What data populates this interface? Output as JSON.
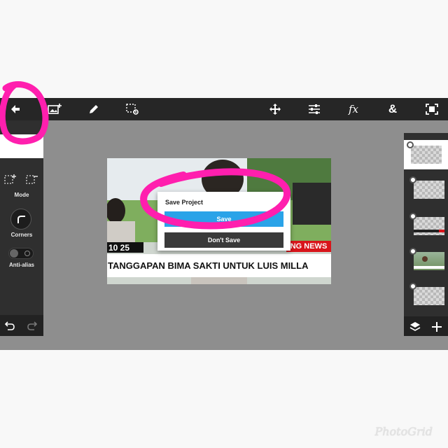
{
  "left_panel": {
    "mode_label": "Mode",
    "corners_label": "Corners",
    "antialias_label": "Anti-alias"
  },
  "dialog": {
    "title": "Save Project",
    "save_label": "Save",
    "dont_save_label": "Don't Save"
  },
  "image": {
    "time_text": "10 25",
    "news_tag": "NG NEWS",
    "headline": "TANGGAPAN BIMA SAKTI UNTUK LUIS MILLA"
  },
  "toolbar": {
    "fx_label": "fx",
    "amp_label": "&"
  },
  "watermark": "PhotoGrid",
  "colors": {
    "accent_blue": "#2aa3e8",
    "annotation_pink": "#ff1fae",
    "news_red": "#d8151b"
  }
}
